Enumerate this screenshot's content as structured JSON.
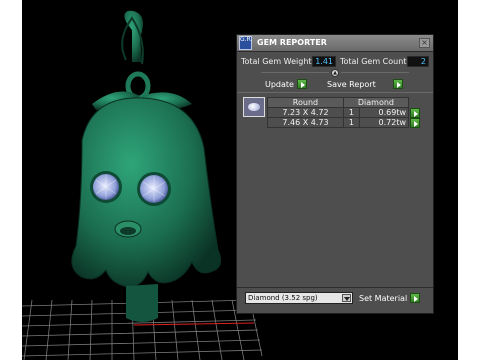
{
  "panel": {
    "title": "GEM REPORTER",
    "app_icon_text": "G.R.",
    "close_glyph": "×",
    "total_weight_label": "Total Gem Weight",
    "total_weight_value": "1.41",
    "total_count_label": "Total Gem Count",
    "total_count_value": "2",
    "update_label": "Update",
    "save_report_label": "Save Report",
    "table": {
      "headers": [
        "Round",
        "Diamond"
      ],
      "rows": [
        {
          "size": "7.23 X 4.72",
          "count": "1",
          "weight": "0.69tw"
        },
        {
          "size": "7.46 X 4.73",
          "count": "1",
          "weight": "0.72tw"
        }
      ]
    },
    "material_value": "Diamond   (3.52 spg)",
    "set_material_label": "Set Material"
  },
  "colors": {
    "viewport_bg": "#000000",
    "model_green": "#1f7a5a",
    "grid": "#8a8a8a",
    "accent_value": "#4fc3ff",
    "button_green": "#3f9a2f"
  },
  "icons": {
    "app": "gem-reporter-app-icon",
    "close": "close-icon",
    "collapse": "collapse-toggle-icon",
    "play": "green-play-arrow-icon",
    "gem": "round-diamond-gem-icon",
    "dropdown": "chevron-down-icon"
  }
}
